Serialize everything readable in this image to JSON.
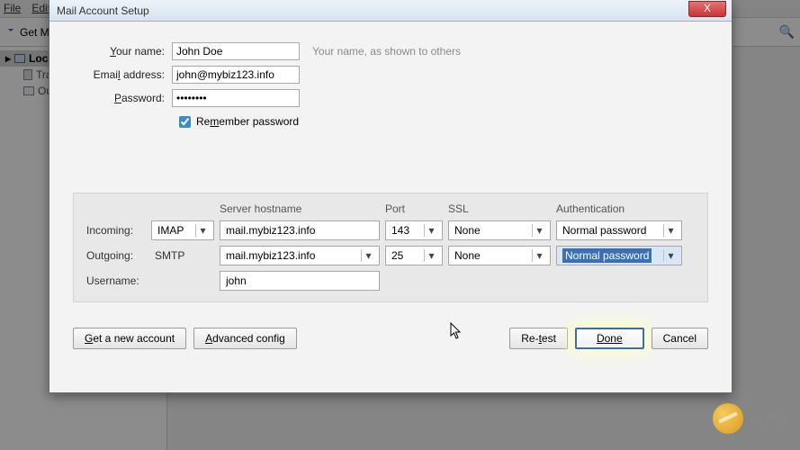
{
  "bg": {
    "menu": {
      "file": "File",
      "edit": "Edit"
    },
    "get_mail": "Get M",
    "sidebar": {
      "root": "Loca",
      "trash": "Tra",
      "outbox": "Ou"
    }
  },
  "dialog": {
    "title": "Mail Account Setup",
    "close": "X",
    "name_label": "Your name:",
    "name_value": "John Doe",
    "name_hint": "Your name, as shown to others",
    "email_label": "Email address:",
    "email_value": "john@mybiz123.info",
    "password_label": "Password:",
    "password_value": "••••••••",
    "remember_label": "Remember password",
    "headers": {
      "host": "Server hostname",
      "port": "Port",
      "ssl": "SSL",
      "auth": "Authentication"
    },
    "incoming_label": "Incoming:",
    "outgoing_label": "Outgoing:",
    "username_label": "Username:",
    "incoming": {
      "type": "IMAP",
      "host": "mail.mybiz123.info",
      "port": "143",
      "ssl": "None",
      "auth": "Normal password"
    },
    "outgoing": {
      "type": "SMTP",
      "host": "mail.mybiz123.info",
      "port": "25",
      "ssl": "None",
      "auth": "Normal password"
    },
    "username": "john",
    "buttons": {
      "new_account": "Get a new account",
      "advanced": "Advanced config",
      "retest": "Re-test",
      "done": "Done",
      "cancel": "Cancel"
    }
  },
  "watermark": "FastCo"
}
